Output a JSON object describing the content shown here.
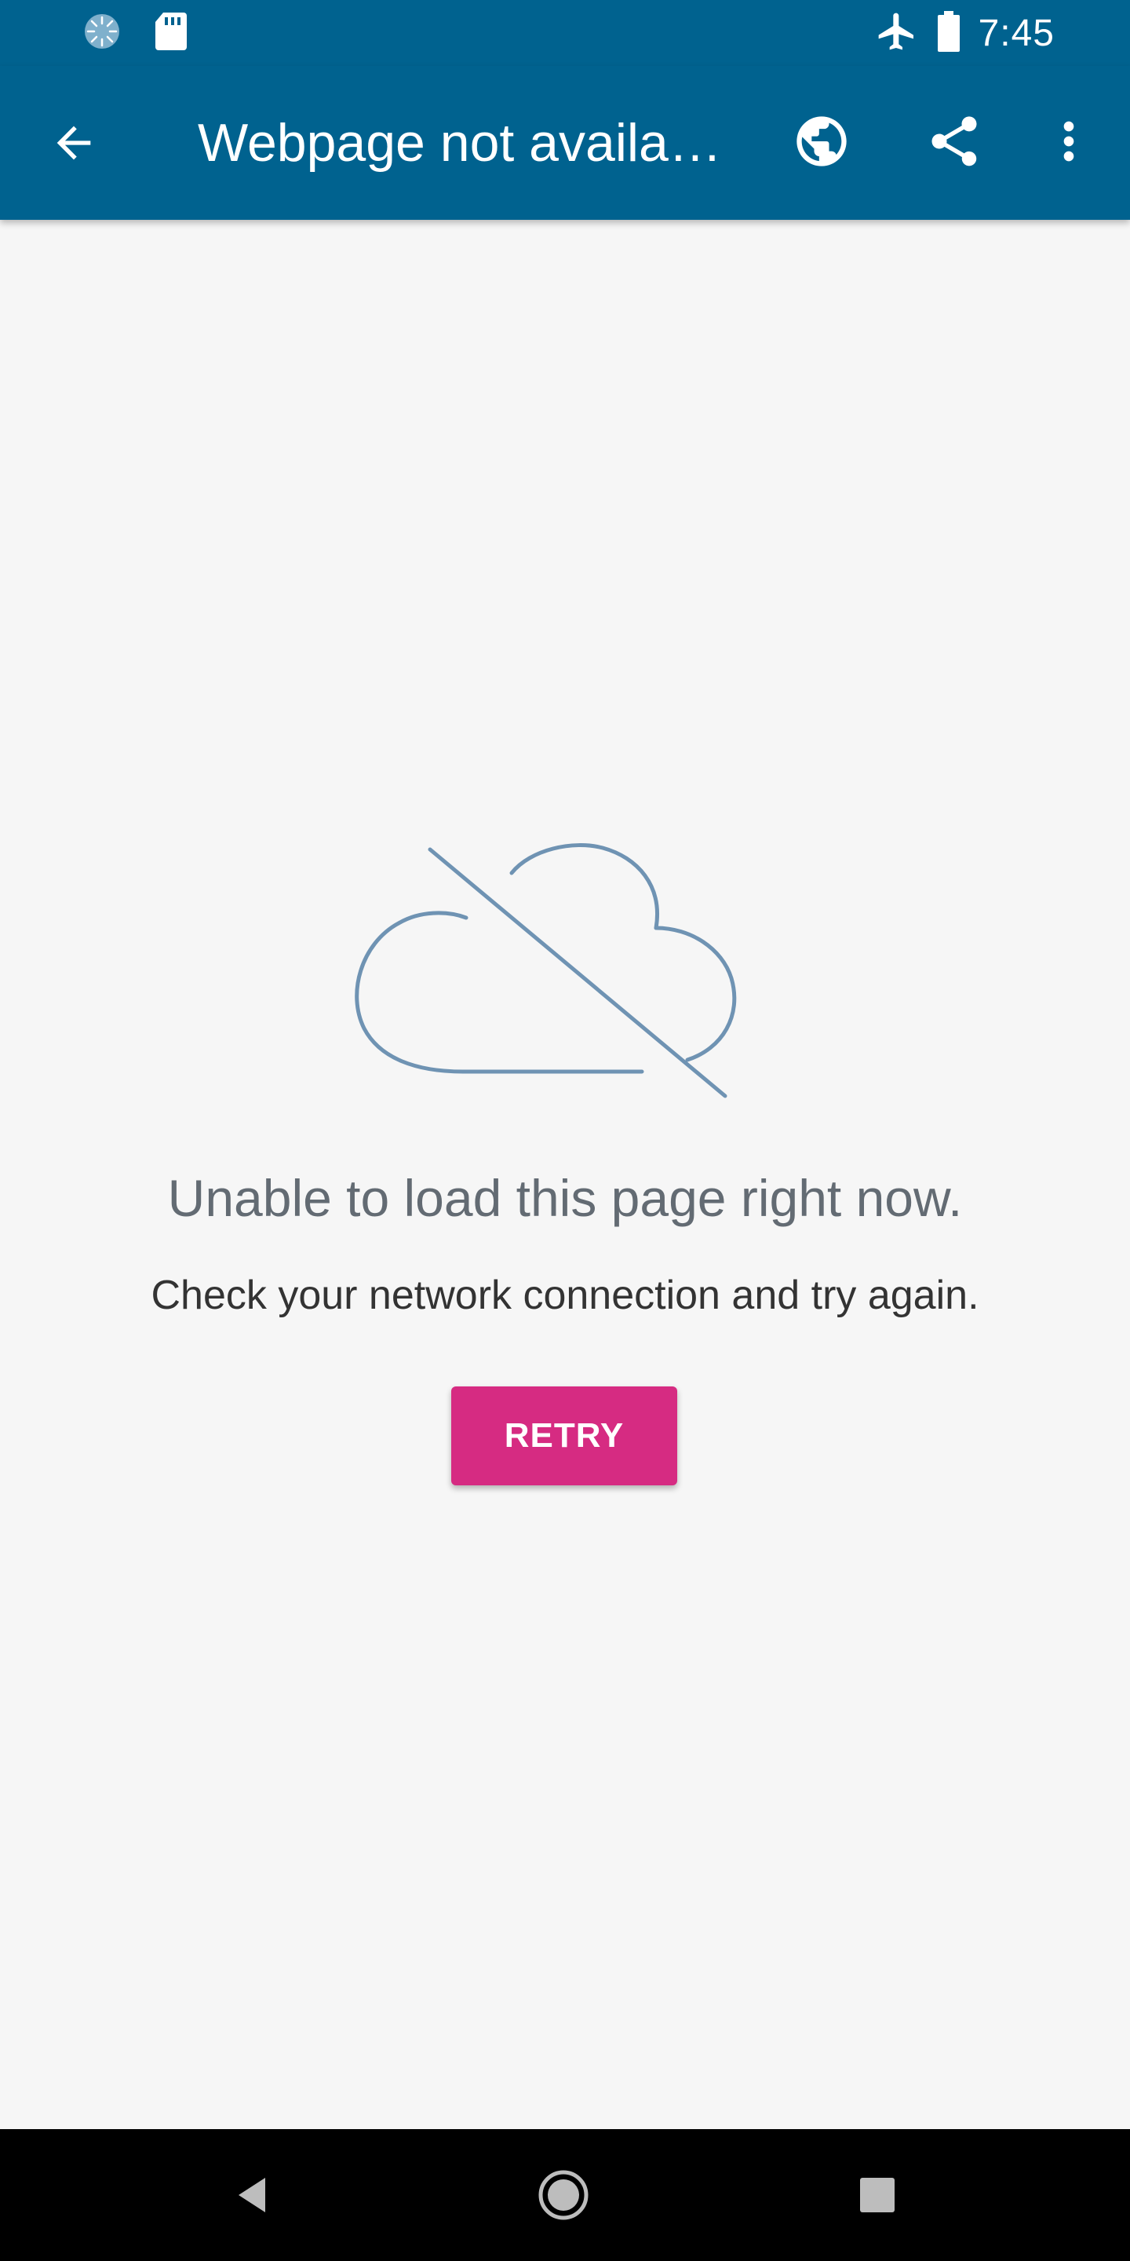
{
  "status_bar": {
    "time": "7:45",
    "left_icons": [
      "sync-spinner-icon",
      "sd-card-icon"
    ],
    "right_icons": [
      "airplane-mode-icon",
      "battery-icon"
    ]
  },
  "app_bar": {
    "title": "Webpage not availa…",
    "back_icon": "arrow-back-icon",
    "actions": [
      "globe-icon",
      "share-icon",
      "more-vert-icon"
    ],
    "color": "#00628f"
  },
  "error": {
    "illustration": "cloud-offline-icon",
    "title": "Unable to load this page right now.",
    "subtitle": "Check your network connection and try again.",
    "retry_label": "RETRY",
    "retry_color": "#d62b82",
    "illustration_color": "#6f93b3"
  },
  "nav_bar": {
    "buttons": [
      "nav-back-icon",
      "nav-home-icon",
      "nav-recents-icon"
    ]
  }
}
